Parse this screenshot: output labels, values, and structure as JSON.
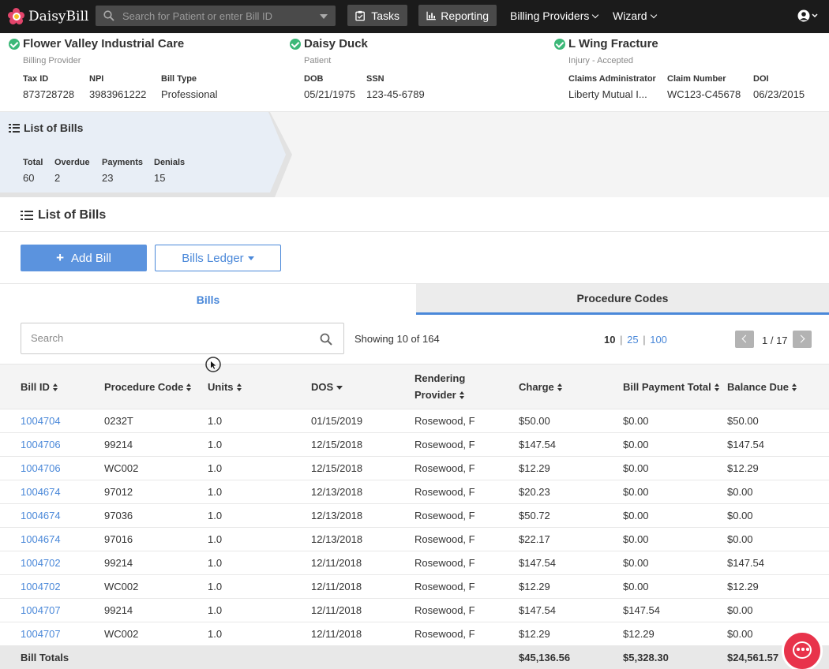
{
  "app": {
    "logo_text": "DaisyBill",
    "search_placeholder": "Search for Patient or enter Bill ID",
    "nav": {
      "tasks": "Tasks",
      "reporting": "Reporting",
      "billing_providers": "Billing Providers",
      "wizard": "Wizard"
    }
  },
  "context": {
    "provider": {
      "name": "Flower Valley Industrial Care",
      "role": "Billing Provider",
      "fields": [
        {
          "label": "Tax ID",
          "value": "873728728"
        },
        {
          "label": "NPI",
          "value": "3983961222"
        },
        {
          "label": "Bill Type",
          "value": "Professional"
        }
      ]
    },
    "patient": {
      "name": "Daisy Duck",
      "role": "Patient",
      "fields": [
        {
          "label": "DOB",
          "value": "05/21/1975"
        },
        {
          "label": "SSN",
          "value": "123-45-6789"
        }
      ]
    },
    "injury": {
      "name": "L Wing Fracture",
      "role": "Injury - Accepted",
      "fields": [
        {
          "label": "Claims Administrator",
          "value": "Liberty Mutual I..."
        },
        {
          "label": "Claim Number",
          "value": "WC123-C45678"
        },
        {
          "label": "DOI",
          "value": "06/23/2015"
        }
      ]
    }
  },
  "summary": {
    "title": "List of Bills",
    "stats": [
      {
        "label": "Total",
        "value": "60"
      },
      {
        "label": "Overdue",
        "value": "2"
      },
      {
        "label": "Payments",
        "value": "23"
      },
      {
        "label": "Denials",
        "value": "15"
      }
    ]
  },
  "section": {
    "title": "List of Bills",
    "add_bill": "Add Bill",
    "bills_ledger": "Bills Ledger"
  },
  "tabs": {
    "bills": "Bills",
    "procedure_codes": "Procedure Codes"
  },
  "table_toolbar": {
    "search_placeholder": "Search",
    "showing": "Showing 10 of 164",
    "per_page": [
      "10",
      "25",
      "100"
    ],
    "page": "1 / 17"
  },
  "table": {
    "headers": {
      "bill_id": "Bill ID",
      "procedure_code": "Procedure Code",
      "units": "Units",
      "dos": "DOS",
      "rendering_1": "Rendering",
      "rendering_2": "Provider",
      "charge": "Charge",
      "bill_payment_total": "Bill Payment Total",
      "balance_due": "Balance Due"
    },
    "rows": [
      {
        "bill_id": "1004704",
        "code": "0232T",
        "units": "1.0",
        "dos": "01/15/2019",
        "provider": "Rosewood, F",
        "charge": "$50.00",
        "payment": "$0.00",
        "balance": "$50.00"
      },
      {
        "bill_id": "1004706",
        "code": "99214",
        "units": "1.0",
        "dos": "12/15/2018",
        "provider": "Rosewood, F",
        "charge": "$147.54",
        "payment": "$0.00",
        "balance": "$147.54"
      },
      {
        "bill_id": "1004706",
        "code": "WC002",
        "units": "1.0",
        "dos": "12/15/2018",
        "provider": "Rosewood, F",
        "charge": "$12.29",
        "payment": "$0.00",
        "balance": "$12.29"
      },
      {
        "bill_id": "1004674",
        "code": "97012",
        "units": "1.0",
        "dos": "12/13/2018",
        "provider": "Rosewood, F",
        "charge": "$20.23",
        "payment": "$0.00",
        "balance": "$0.00"
      },
      {
        "bill_id": "1004674",
        "code": "97036",
        "units": "1.0",
        "dos": "12/13/2018",
        "provider": "Rosewood, F",
        "charge": "$50.72",
        "payment": "$0.00",
        "balance": "$0.00"
      },
      {
        "bill_id": "1004674",
        "code": "97016",
        "units": "1.0",
        "dos": "12/13/2018",
        "provider": "Rosewood, F",
        "charge": "$22.17",
        "payment": "$0.00",
        "balance": "$0.00"
      },
      {
        "bill_id": "1004702",
        "code": "99214",
        "units": "1.0",
        "dos": "12/11/2018",
        "provider": "Rosewood, F",
        "charge": "$147.54",
        "payment": "$0.00",
        "balance": "$147.54"
      },
      {
        "bill_id": "1004702",
        "code": "WC002",
        "units": "1.0",
        "dos": "12/11/2018",
        "provider": "Rosewood, F",
        "charge": "$12.29",
        "payment": "$0.00",
        "balance": "$12.29"
      },
      {
        "bill_id": "1004707",
        "code": "99214",
        "units": "1.0",
        "dos": "12/11/2018",
        "provider": "Rosewood, F",
        "charge": "$147.54",
        "payment": "$147.54",
        "balance": "$0.00"
      },
      {
        "bill_id": "1004707",
        "code": "WC002",
        "units": "1.0",
        "dos": "12/11/2018",
        "provider": "Rosewood, F",
        "charge": "$12.29",
        "payment": "$12.29",
        "balance": "$0.00"
      }
    ],
    "totals": {
      "label": "Bill Totals",
      "charge": "$45,136.56",
      "payment": "$5,328.30",
      "balance": "$24,561.57"
    }
  },
  "colors": {
    "accent": "#4a88d9",
    "primary_button": "#5b93de",
    "success": "#3cb878",
    "chat": "#e8334b",
    "nav_bg": "#1b1b1b"
  }
}
